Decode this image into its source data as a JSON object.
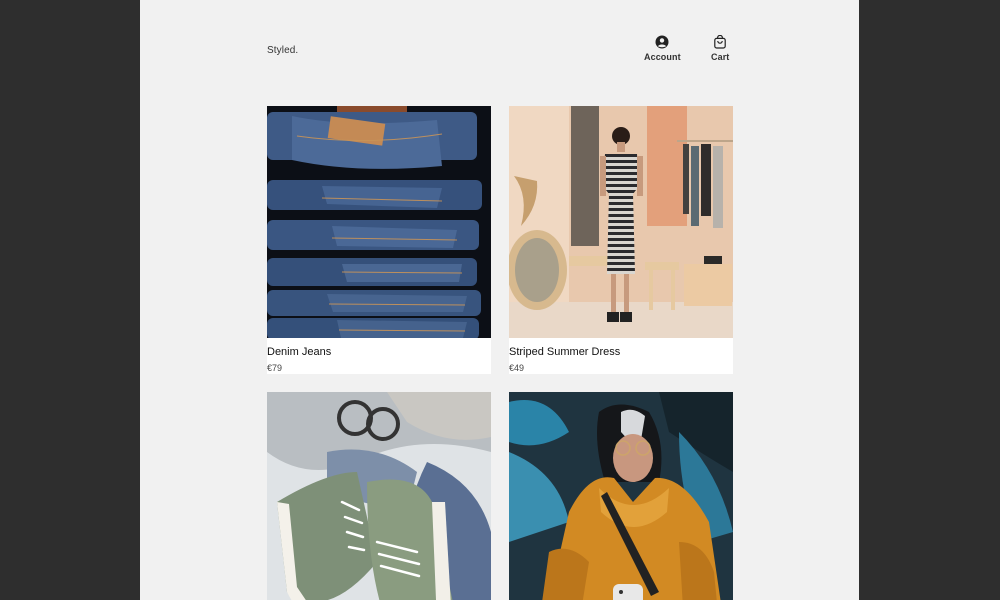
{
  "header": {
    "brand": "Styled.",
    "nav": [
      {
        "label": "Account",
        "icon": "account-icon"
      },
      {
        "label": "Cart",
        "icon": "cart-icon"
      }
    ]
  },
  "products": [
    {
      "name": "Denim Jeans",
      "price": "€79",
      "image": "stacked-denim-jeans-photo"
    },
    {
      "name": "Striped Summer Dress",
      "price": "€49",
      "image": "woman-striped-dress-photo"
    },
    {
      "name": "",
      "price": "",
      "image": "green-sneakers-sunglasses-photo"
    },
    {
      "name": "",
      "price": "",
      "image": "woman-orange-puffer-jacket-photo"
    }
  ],
  "colors": {
    "backdrop": "#2e2e2e",
    "page": "#f1f1f1",
    "card": "#ffffff",
    "text": "#111111"
  }
}
